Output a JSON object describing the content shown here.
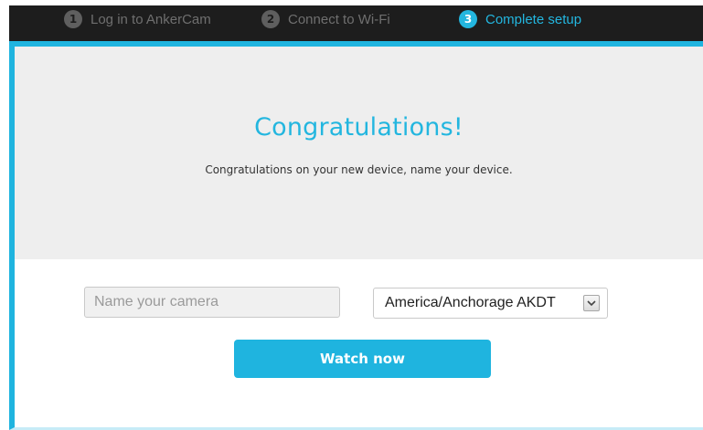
{
  "steps": [
    {
      "number": "1",
      "label": "Log in to AnkerCam",
      "state": "done"
    },
    {
      "number": "2",
      "label": "Connect to Wi-Fi",
      "state": "done"
    },
    {
      "number": "3",
      "label": "Complete setup",
      "state": "active"
    }
  ],
  "hero": {
    "title": "Congratulations!",
    "subtitle": "Congratulations on your new device, name your device."
  },
  "form": {
    "name_placeholder": "Name your camera",
    "name_value": "",
    "timezone_selected": "America/Anchorage AKDT"
  },
  "actions": {
    "watch_label": "Watch now"
  },
  "icons": {
    "select_arrow": "chevron-down-icon"
  },
  "colors": {
    "accent": "#1fb4df",
    "step_bar": "#1d1d1d",
    "inactive_step": "#6f6f6f",
    "hero_bg": "#eeeeee"
  }
}
